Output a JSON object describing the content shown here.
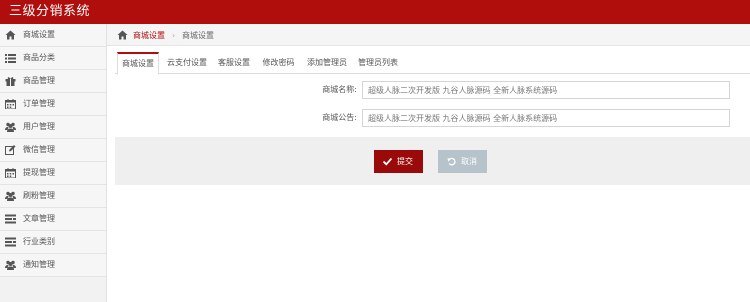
{
  "app": {
    "title": "三级分销系统"
  },
  "colors": {
    "brand": "#b00d0d",
    "submit": "#9b0a0a",
    "cancel": "#b7c3ca",
    "sidebar_bg": "#f2f2f2",
    "action_bar_bg": "#efefef"
  },
  "sidebar": {
    "items": [
      {
        "label": "商城设置",
        "icon": "home-icon"
      },
      {
        "label": "商品分类",
        "icon": "list-icon"
      },
      {
        "label": "商品管理",
        "icon": "gift-icon"
      },
      {
        "label": "订单管理",
        "icon": "calendar-icon"
      },
      {
        "label": "用户管理",
        "icon": "users-icon"
      },
      {
        "label": "微信管理",
        "icon": "edit-icon"
      },
      {
        "label": "提现管理",
        "icon": "calendar-icon"
      },
      {
        "label": "刷粉管理",
        "icon": "users-icon"
      },
      {
        "label": "文章管理",
        "icon": "document-list-icon"
      },
      {
        "label": "行业类别",
        "icon": "document-list-icon"
      },
      {
        "label": "通知管理",
        "icon": "users-icon"
      }
    ]
  },
  "breadcrumb": {
    "link": "商城设置",
    "separator": "›",
    "current": "商城设置",
    "icon": "home-icon"
  },
  "tabs": [
    {
      "label": "商城设置",
      "active": true
    },
    {
      "label": "云支付设置",
      "active": false
    },
    {
      "label": "客服设置",
      "active": false
    },
    {
      "label": "修改密码",
      "active": false
    },
    {
      "label": "添加管理员",
      "active": false
    },
    {
      "label": "管理员列表",
      "active": false
    }
  ],
  "form": {
    "mall_name": {
      "label": "商城名称:",
      "value": "超级人脉二次开发版 九谷人脉源码 全新人脉系统源码"
    },
    "mall_notice": {
      "label": "商城公告:",
      "value": "超级人脉二次开发版 九谷人脉源码 全新人脉系统源码"
    }
  },
  "actions": {
    "submit": {
      "label": "提交",
      "icon": "check-icon"
    },
    "cancel": {
      "label": "取消",
      "icon": "undo-icon"
    }
  }
}
